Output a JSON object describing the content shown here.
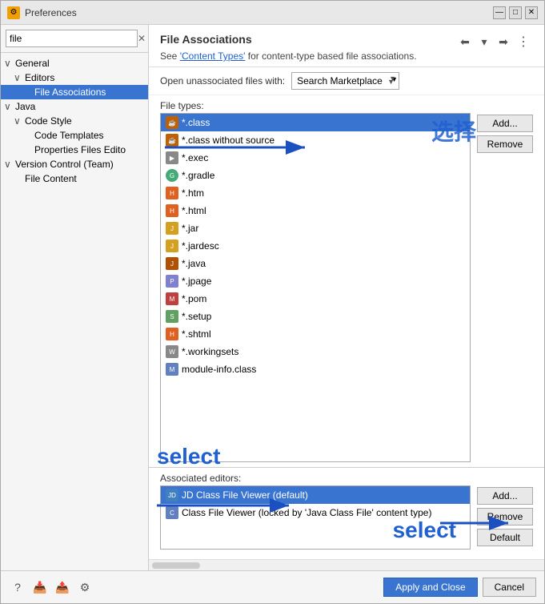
{
  "window": {
    "title": "Preferences",
    "icon": "⚙"
  },
  "search": {
    "value": "file",
    "placeholder": "file"
  },
  "sidebar": {
    "items": [
      {
        "id": "general",
        "label": "General",
        "level": 0,
        "expanded": true
      },
      {
        "id": "editors",
        "label": "Editors",
        "level": 1,
        "expanded": true
      },
      {
        "id": "file-assoc",
        "label": "File Associations",
        "level": 2,
        "selected": true
      },
      {
        "id": "java",
        "label": "Java",
        "level": 0,
        "expanded": true
      },
      {
        "id": "code-style",
        "label": "Code Style",
        "level": 1,
        "expanded": true
      },
      {
        "id": "code-templates",
        "label": "Code Templates",
        "level": 2
      },
      {
        "id": "props-files",
        "label": "Properties Files Edito",
        "level": 2
      },
      {
        "id": "version-control",
        "label": "Version Control (Team)",
        "level": 0,
        "expanded": true
      },
      {
        "id": "file-content",
        "label": "File Content",
        "level": 1
      }
    ]
  },
  "panel": {
    "title": "File Associations",
    "desc_prefix": "See ",
    "desc_link": "'Content Types'",
    "desc_suffix": " for content-type based file associations.",
    "open_with_label": "Open unassociated files with:",
    "open_with_value": "Search Marketplace",
    "file_types_label": "File types:",
    "associated_label": "Associated editors:"
  },
  "file_types": [
    {
      "icon": "class",
      "label": "*.class",
      "selected": true
    },
    {
      "icon": "class",
      "label": "*.class without source"
    },
    {
      "icon": "exec",
      "label": "*.exec"
    },
    {
      "icon": "gradle",
      "label": "*.gradle"
    },
    {
      "icon": "htm",
      "label": "*.htm"
    },
    {
      "icon": "html",
      "label": "*.html"
    },
    {
      "icon": "jar",
      "label": "*.jar"
    },
    {
      "icon": "jar",
      "label": "*.jardesc"
    },
    {
      "icon": "java",
      "label": "*.java"
    },
    {
      "icon": "xml",
      "label": "*.jpage"
    },
    {
      "icon": "pom",
      "label": "*.pom"
    },
    {
      "icon": "setup",
      "label": "*.setup"
    },
    {
      "icon": "shtml",
      "label": "*.shtml"
    },
    {
      "icon": "working",
      "label": "*.workingsets"
    },
    {
      "icon": "module",
      "label": "module-info.class"
    }
  ],
  "buttons": {
    "file_add": "Add...",
    "file_remove": "Remove",
    "assoc_add": "Add...",
    "assoc_remove": "Remove",
    "assoc_default": "Default",
    "apply_close": "Apply and Close",
    "cancel": "Cancel"
  },
  "associated_editors": [
    {
      "icon": "jd",
      "label": "JD Class File Viewer (default)",
      "selected": true
    },
    {
      "icon": "class",
      "label": "Class File Viewer (locked by 'Java Class File' content type)"
    }
  ],
  "annotations": {
    "zh_select": "选择",
    "en_select1": "select",
    "en_select2": "select"
  }
}
